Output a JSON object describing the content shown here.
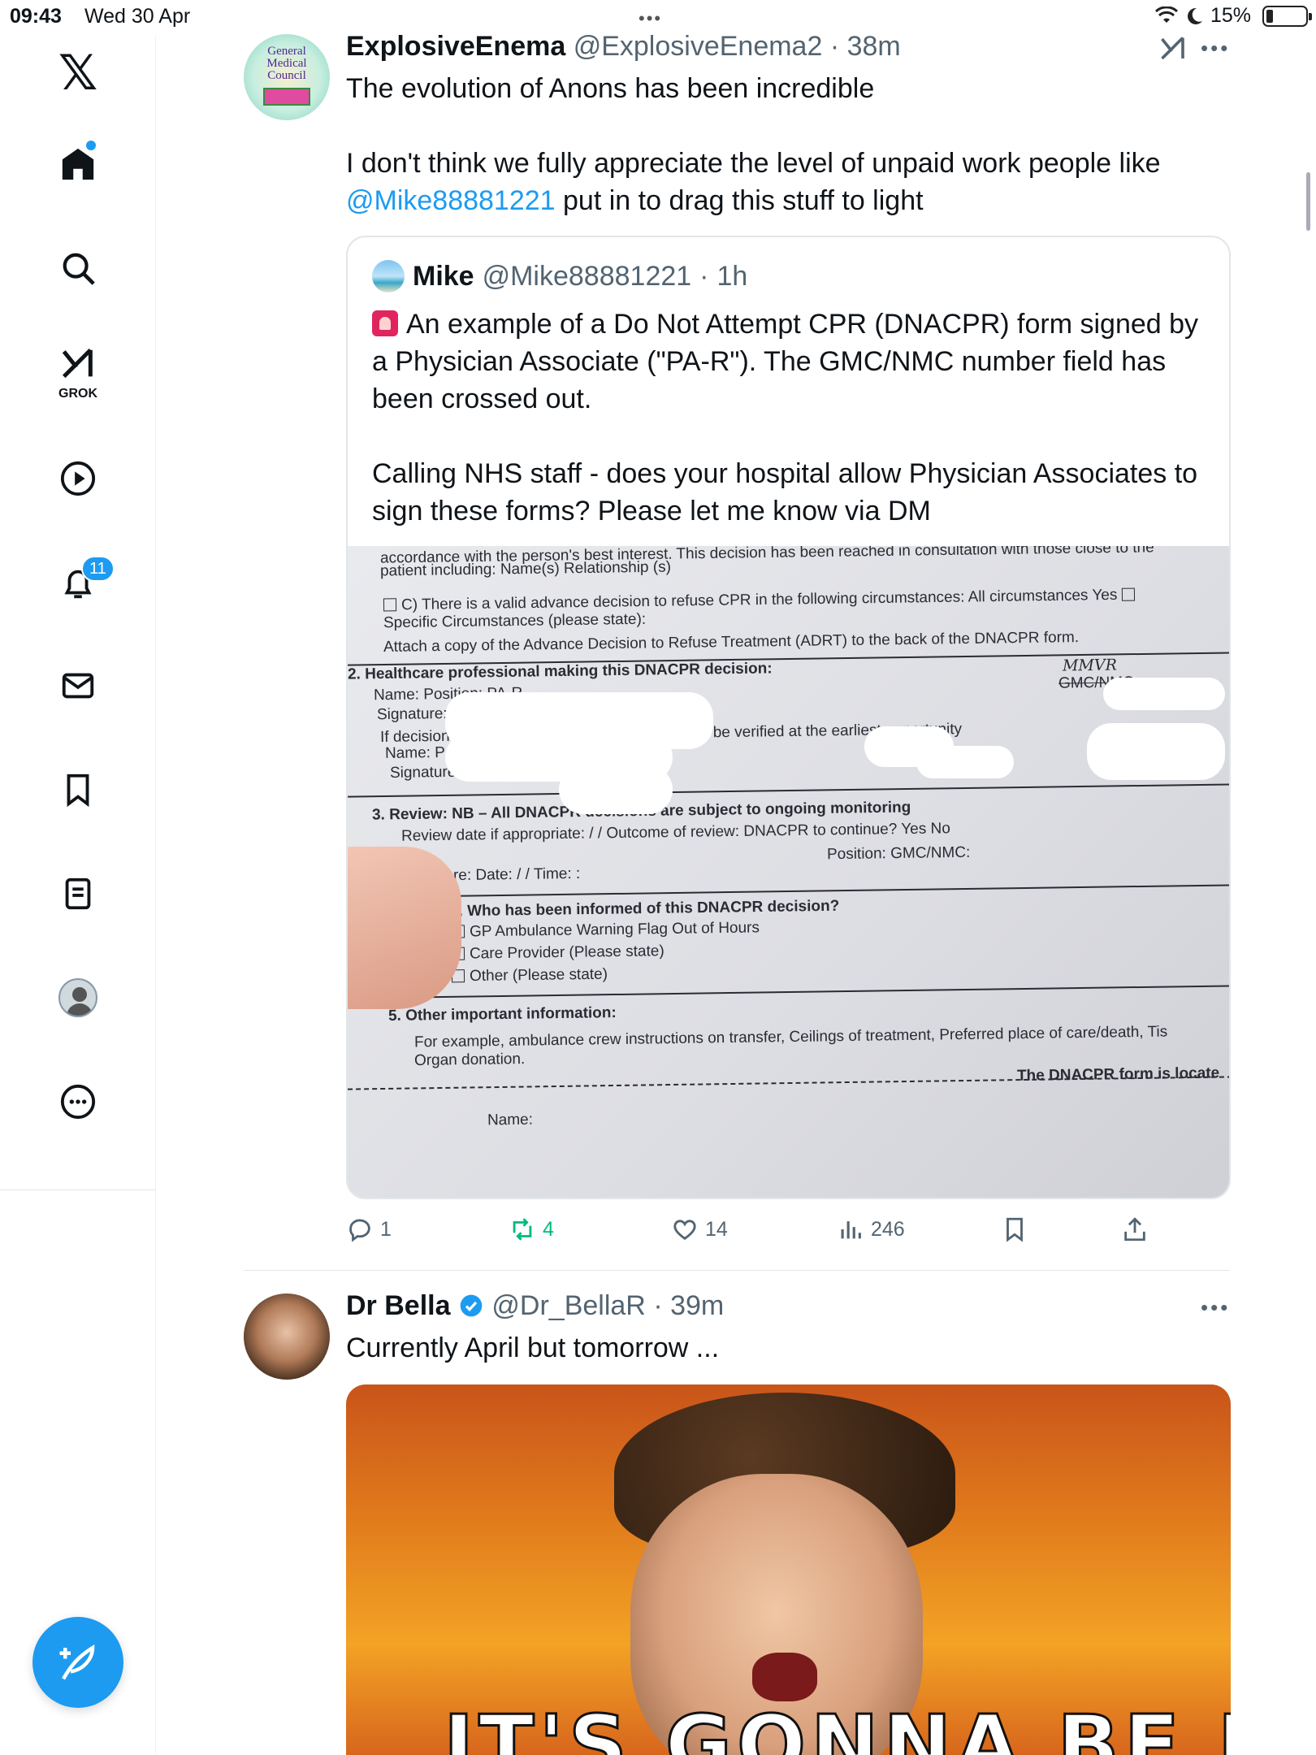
{
  "status_bar": {
    "time": "09:43",
    "date": "Wed 30 Apr",
    "battery": "15%"
  },
  "sidebar": {
    "logo": "𝕏",
    "grok_label": "GROK",
    "notifications_badge": "11"
  },
  "tweet1": {
    "name": "ExplosiveEnema",
    "handle": "@ExplosiveEnema2",
    "time": "38m",
    "line1": "The evolution of Anons has been incredible",
    "line2a": "I don't think we fully appreciate the level of unpaid work people like",
    "mention": "@Mike88881221",
    "line2b": " put in to drag this stuff to light",
    "avatar_text": [
      "General",
      "Medical",
      "Council"
    ],
    "quote": {
      "name": "Mike",
      "handle": "@Mike88881221",
      "time": "1h",
      "text1": "An example of a Do Not Attempt CPR (DNACPR) form signed by a Physician Associate (\"PA-R\"). The GMC/NMC number field has been crossed out.",
      "text2": "Calling NHS staff - does your hospital allow Physician Associates to sign these forms? Please let me know via DM",
      "form_lines": [
        "accordance with the person's best interest. This decision has  been reached in consultation with those close to the",
        "patient including: Name(s)                                                            Relationship (s)",
        "C) There is a valid advance decision to refuse CPR in the following circumstances: All circumstances Yes",
        "Specific Circumstances (please state):",
        "Attach a copy of the Advance Decision to Refuse Treatment (ADRT) to the back of the DNACPR form.",
        "2. Healthcare professional making this DNACPR decision:",
        "Name:                                                        Position:  PA-R",
        "Signature:                                                   Date:        24 .",
        "If decision made by                              professional, the decision to be verified at the earliest opportunity",
        "Name:                                                            Position:",
        "Signature:                                                       Date:",
        "3. Review: NB – All DNACPR decisions are subject to ongoing monitoring",
        "Review date if appropriate:    /    /            Outcome of review: DNACPR to continue?  Yes       No",
        "Position:                               GMC/NMC:",
        "re:                                                               Date:     /     /                       Time:      :",
        "4. Who has been informed of this DNACPR decision?",
        "GP                                          Ambulance Warning Flag                     Out of Hours",
        "Care Provider (Please state)",
        "Other (Please state)",
        "5. Other important information:",
        "For example, ambulance crew instructions on transfer, Ceilings of treatment, Preferred place of care/death, Tis",
        "Organ donation.",
        "The DNACPR form is locate",
        "Name:"
      ],
      "form_annotations": {
        "gmc_field": "GMC/NMC:",
        "handwritten": "MMVR"
      }
    },
    "actions": {
      "replies": "1",
      "reposts": "4",
      "likes": "14",
      "views": "246"
    }
  },
  "tweet2": {
    "name": "Dr Bella",
    "handle": "@Dr_BellaR",
    "time": "39m",
    "text": "Currently April but tomorrow ...",
    "image_caption": "IT'S GONNA BE MAY"
  },
  "colors": {
    "accent": "#1d9bf0",
    "repost": "#00ba7c",
    "muted": "#536471"
  }
}
